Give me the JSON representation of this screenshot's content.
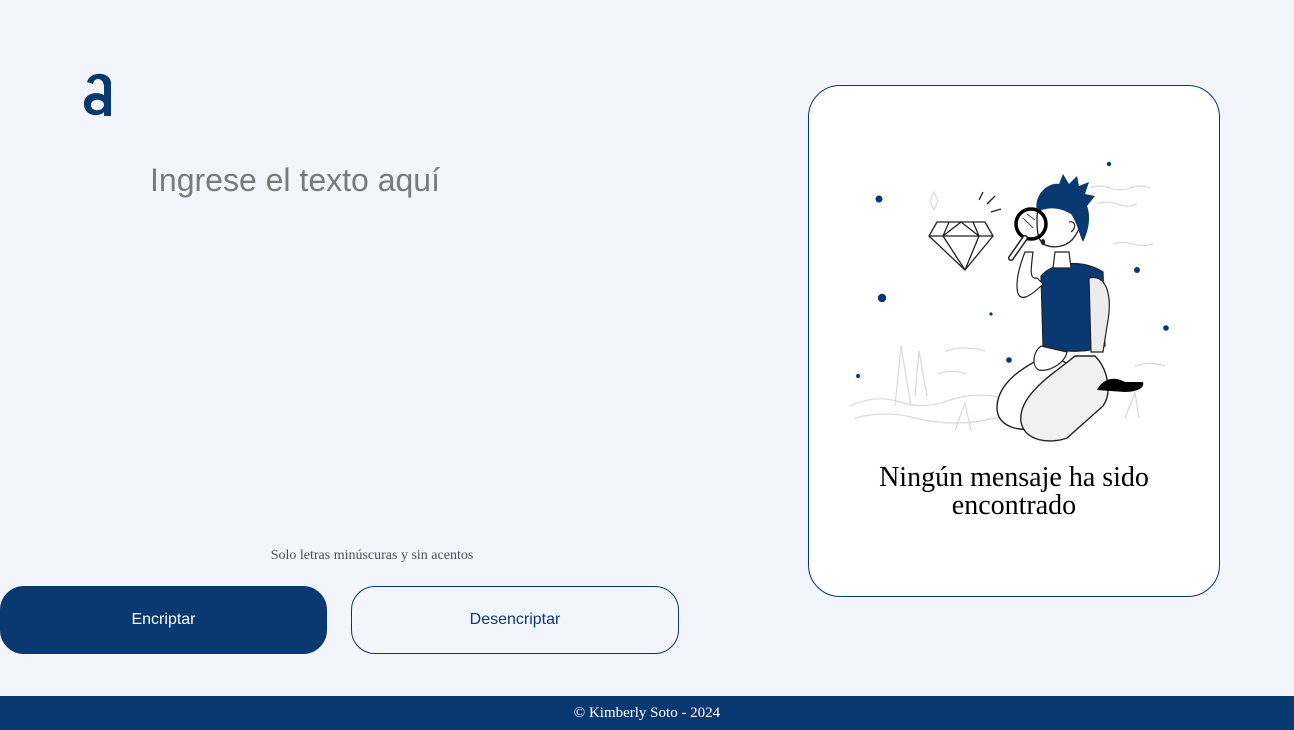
{
  "logo": {
    "icon": "alura-a-logo-icon",
    "color": "#0a3871"
  },
  "input": {
    "placeholder": "Ingrese el texto aquí",
    "value": ""
  },
  "hint": {
    "text": "Solo letras minúscuras y sin acentos"
  },
  "buttons": {
    "encrypt_label": "Encriptar",
    "decrypt_label": "Desencriptar"
  },
  "output": {
    "illustration": "person-with-magnifying-glass-and-diamond-illustration",
    "title": "Ningún mensaje ha sido encontrado"
  },
  "footer": {
    "text": "© Kimberly Soto - 2024"
  },
  "colors": {
    "primary": "#0a3871",
    "background": "#f3f5fc",
    "card": "#ffffff"
  }
}
